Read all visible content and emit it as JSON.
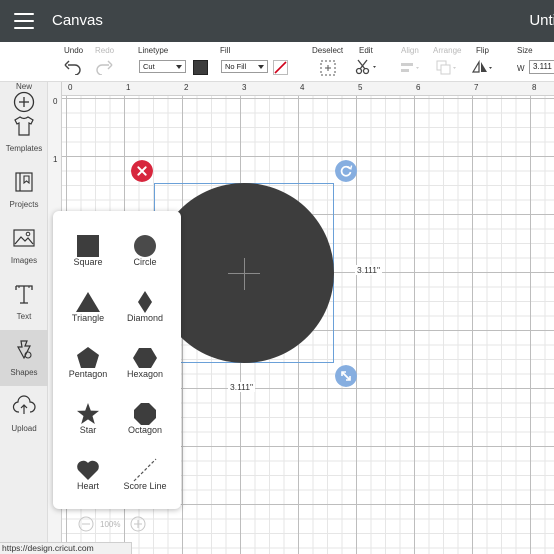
{
  "topbar": {
    "title": "Canvas",
    "project_title": "Unti"
  },
  "toolbar": {
    "undo": "Undo",
    "redo": "Redo",
    "linetype": {
      "label": "Linetype",
      "value": "Cut"
    },
    "fill": {
      "label": "Fill",
      "value": "No Fill",
      "swatch_color": "#3c3c3c",
      "no_color_slash": "#d0021b"
    },
    "deselect": "Deselect",
    "edit": "Edit",
    "align": "Align",
    "arrange": "Arrange",
    "flip": "Flip",
    "size": {
      "label": "Size",
      "w_label": "W",
      "w_value": "3.111"
    }
  },
  "sidebar": {
    "items": [
      {
        "label": "New",
        "icon": "plus-circle-icon"
      },
      {
        "label": "Templates",
        "icon": "tshirt-icon"
      },
      {
        "label": "Projects",
        "icon": "projects-icon"
      },
      {
        "label": "Images",
        "icon": "image-icon"
      },
      {
        "label": "Text",
        "icon": "text-icon"
      },
      {
        "label": "Shapes",
        "icon": "shapes-icon",
        "active": true
      },
      {
        "label": "Upload",
        "icon": "cloud-upload-icon"
      }
    ]
  },
  "rulers": {
    "top": [
      "0",
      "1",
      "2",
      "3",
      "4",
      "5",
      "6",
      "7",
      "8"
    ],
    "left": [
      "0",
      "1"
    ]
  },
  "canvas": {
    "shape_color": "#3d3d3d",
    "selection_color": "#6aa0d8",
    "delete_color": "#d7263d",
    "width_dim": "3.111\"",
    "height_dim": "3.111\"",
    "zoom": "100%"
  },
  "shapes_panel": {
    "items": [
      {
        "label": "Square",
        "icon": "square-icon"
      },
      {
        "label": "Circle",
        "icon": "circle-icon"
      },
      {
        "label": "Triangle",
        "icon": "triangle-icon"
      },
      {
        "label": "Diamond",
        "icon": "diamond-icon"
      },
      {
        "label": "Pentagon",
        "icon": "pentagon-icon"
      },
      {
        "label": "Hexagon",
        "icon": "hexagon-icon"
      },
      {
        "label": "Star",
        "icon": "star-icon"
      },
      {
        "label": "Octagon",
        "icon": "octagon-icon"
      },
      {
        "label": "Heart",
        "icon": "heart-icon"
      },
      {
        "label": "Score Line",
        "icon": "score-line-icon"
      }
    ]
  },
  "status": {
    "url": "https://design.cricut.com"
  }
}
